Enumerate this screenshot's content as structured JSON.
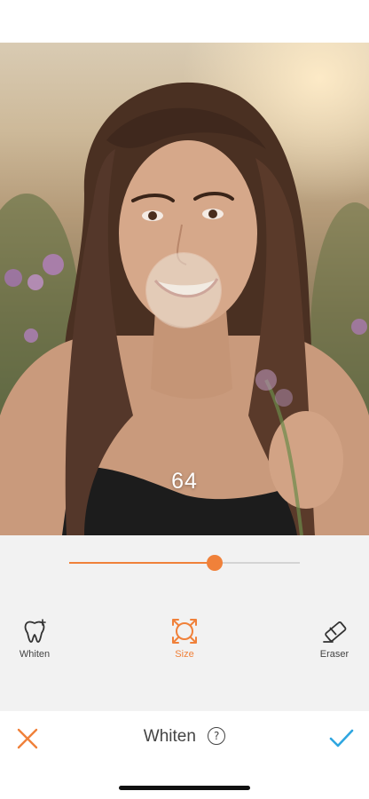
{
  "editor": {
    "brush_size_readout": "64",
    "slider": {
      "value_fraction": 0.63
    },
    "tools": [
      {
        "label": "Whiten",
        "icon": "tooth-icon",
        "active": false
      },
      {
        "label": "Size",
        "icon": "size-icon",
        "active": true
      },
      {
        "label": "Eraser",
        "icon": "eraser-icon",
        "active": false
      }
    ],
    "title": "Whiten",
    "help_glyph": "?"
  },
  "colors": {
    "accent": "#f0813a",
    "confirm": "#2fa6e0",
    "panel": "#f2f2f2",
    "text": "#444444"
  }
}
